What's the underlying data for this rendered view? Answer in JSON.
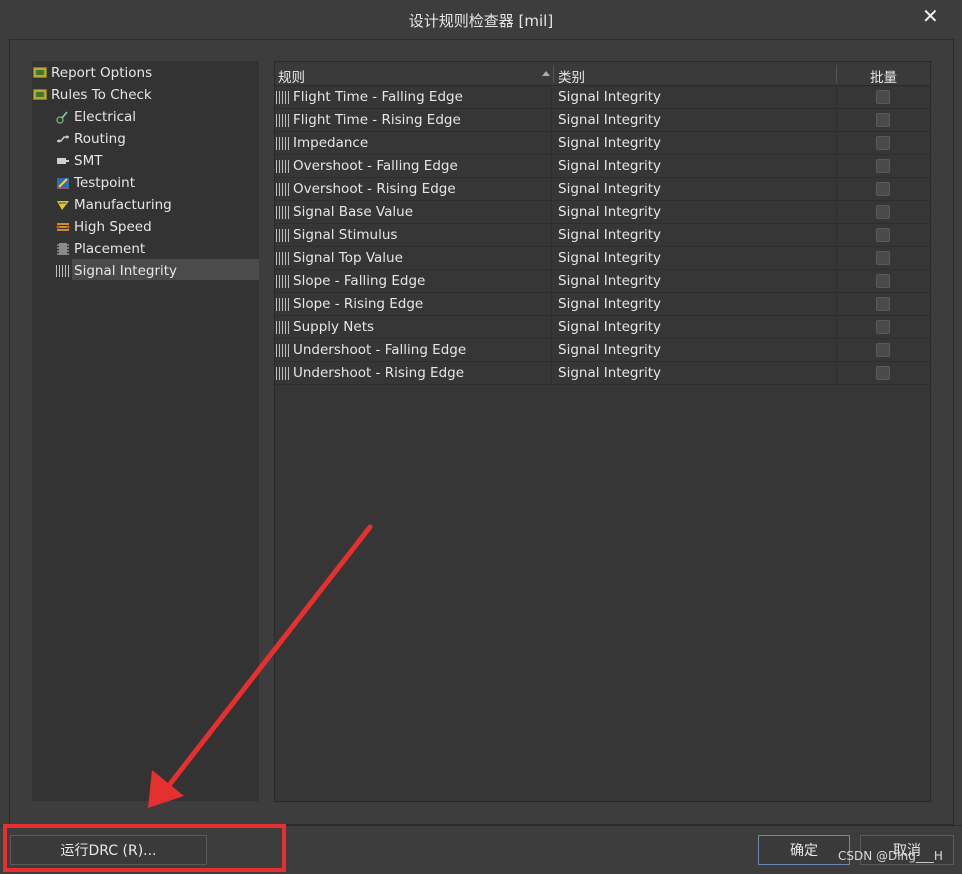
{
  "window": {
    "title": "设计规则检查器 [mil]",
    "close_glyph": "✕"
  },
  "tree": {
    "items": [
      {
        "label": "Report Options",
        "icon": "folder-icon",
        "level": 0
      },
      {
        "label": "Rules To Check",
        "icon": "folder-icon",
        "level": 0
      },
      {
        "label": "Electrical",
        "icon": "electrical-icon",
        "level": 1
      },
      {
        "label": "Routing",
        "icon": "routing-icon",
        "level": 1
      },
      {
        "label": "SMT",
        "icon": "smt-icon",
        "level": 1
      },
      {
        "label": "Testpoint",
        "icon": "testpoint-icon",
        "level": 1
      },
      {
        "label": "Manufacturing",
        "icon": "manufacturing-icon",
        "level": 1
      },
      {
        "label": "High Speed",
        "icon": "high-speed-icon",
        "level": 1
      },
      {
        "label": "Placement",
        "icon": "placement-icon",
        "level": 1
      },
      {
        "label": "Signal Integrity",
        "icon": "signal-integrity-icon",
        "level": 1,
        "selected": true
      }
    ]
  },
  "table": {
    "headers": {
      "rule": "规则",
      "category": "类别",
      "batch": "批量"
    },
    "rows": [
      {
        "rule": "Flight Time - Falling Edge",
        "category": "Signal Integrity",
        "checked": false
      },
      {
        "rule": "Flight Time - Rising Edge",
        "category": "Signal Integrity",
        "checked": false
      },
      {
        "rule": "Impedance",
        "category": "Signal Integrity",
        "checked": false
      },
      {
        "rule": "Overshoot - Falling Edge",
        "category": "Signal Integrity",
        "checked": false
      },
      {
        "rule": "Overshoot - Rising Edge",
        "category": "Signal Integrity",
        "checked": false
      },
      {
        "rule": "Signal Base Value",
        "category": "Signal Integrity",
        "checked": false
      },
      {
        "rule": "Signal Stimulus",
        "category": "Signal Integrity",
        "checked": false
      },
      {
        "rule": "Signal Top Value",
        "category": "Signal Integrity",
        "checked": false
      },
      {
        "rule": "Slope - Falling Edge",
        "category": "Signal Integrity",
        "checked": false
      },
      {
        "rule": "Slope - Rising Edge",
        "category": "Signal Integrity",
        "checked": false
      },
      {
        "rule": "Supply Nets",
        "category": "Signal Integrity",
        "checked": false
      },
      {
        "rule": "Undershoot - Falling Edge",
        "category": "Signal Integrity",
        "checked": false
      },
      {
        "rule": "Undershoot - Rising Edge",
        "category": "Signal Integrity",
        "checked": false
      }
    ]
  },
  "buttons": {
    "run_drc": "运行DRC (R)...",
    "ok": "确定",
    "cancel": "取消"
  },
  "watermark": "CSDN @Ding___H",
  "colors": {
    "annotation_red": "#e53030",
    "ok_border": "#6a8ab0"
  }
}
